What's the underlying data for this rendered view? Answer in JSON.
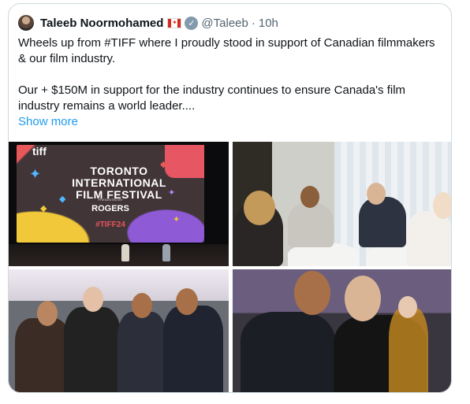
{
  "tweet": {
    "author_name": "Taleeb Noormohamed",
    "flag_emoji": "🇨🇦",
    "handle": "@Taleeb",
    "separator": "·",
    "time": "10h",
    "text_line1": "Wheels up from #TIFF where I proudly stood in support of Canadian filmmakers & our film industry.",
    "text_line2": "Our + $150M in support for the industry continues to ensure Canada's film industry remains a world leader....",
    "show_more_label": "Show more"
  },
  "media": {
    "photo1": {
      "logo": "tiff",
      "title_l1": "TORONTO",
      "title_l2": "INTERNATIONAL",
      "title_l3": "FILM FESTIVAL",
      "presented": "PRESENTED BY",
      "sponsor": "ROGERS",
      "hashtag": "#TIFF24"
    }
  },
  "colors": {
    "link": "#1d9bf0",
    "muted": "#536471",
    "border": "#cfd9de"
  }
}
